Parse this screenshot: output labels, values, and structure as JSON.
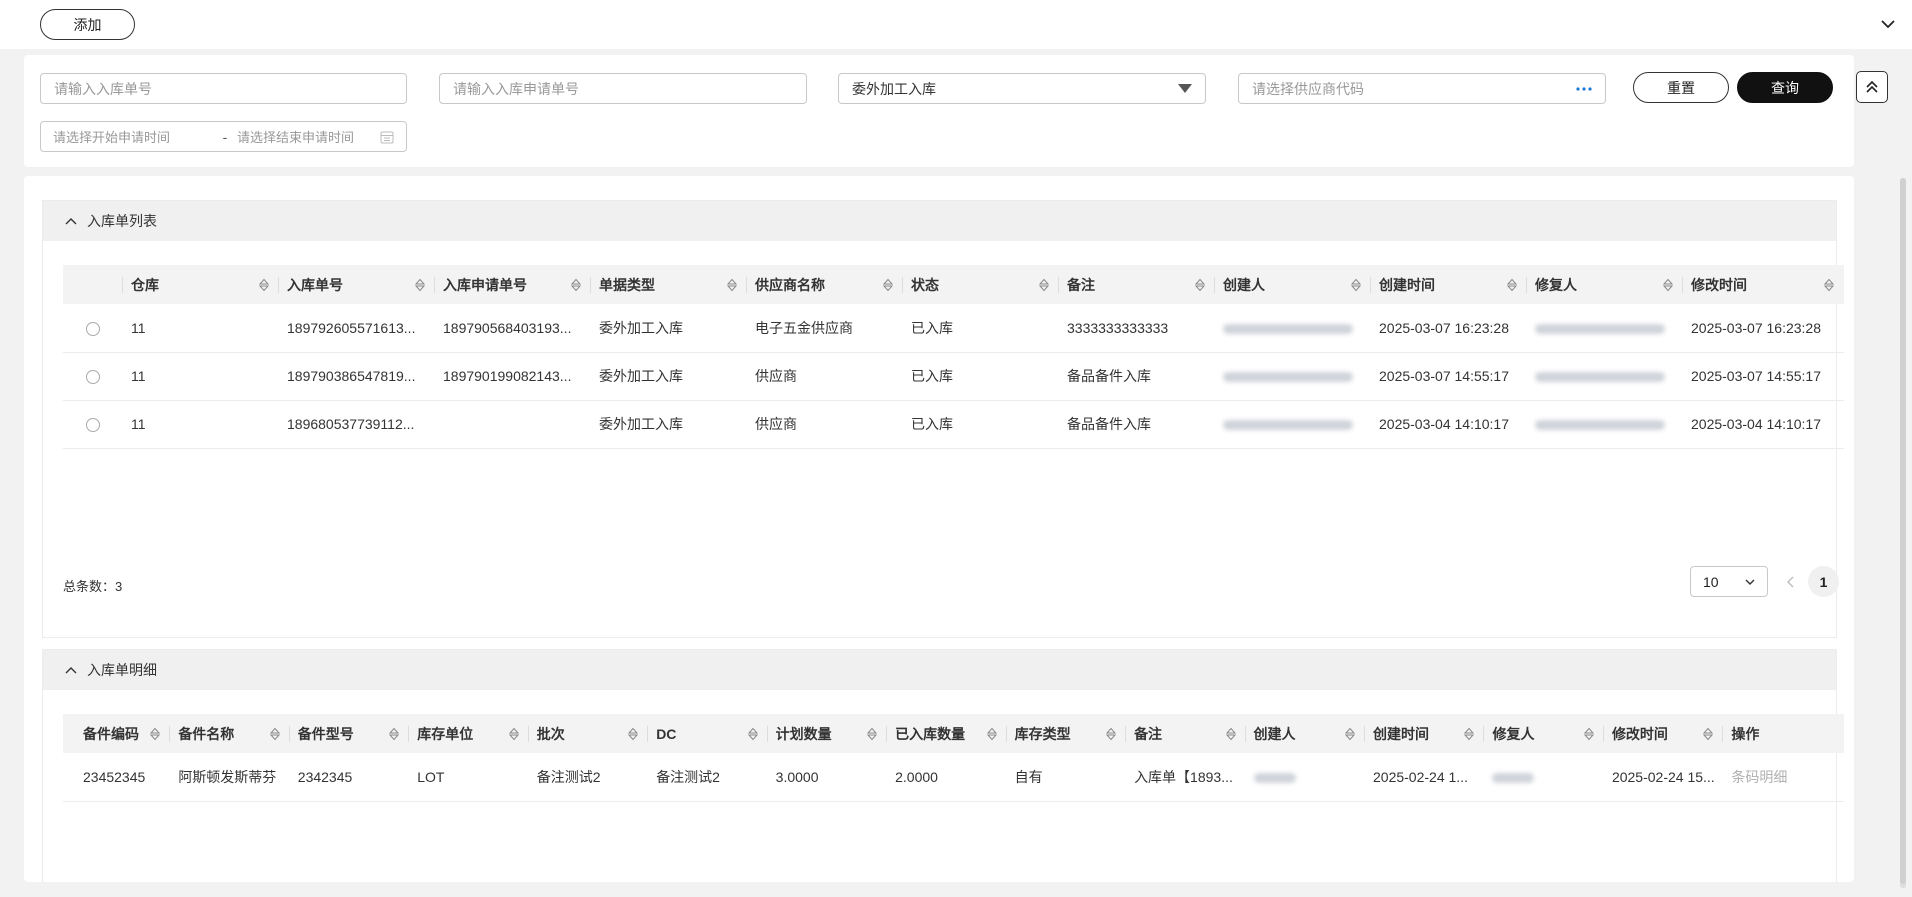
{
  "toolbar": {
    "add_label": "添加"
  },
  "filters": {
    "inbound_no_placeholder": "请输入入库单号",
    "request_no_placeholder": "请输入入库申请单号",
    "type_selected": "委外加工入库",
    "supplier_placeholder": "请选择供应商代码",
    "start_time_placeholder": "请选择开始申请时间",
    "range_sep": "-",
    "end_time_placeholder": "请选择结束申请时间",
    "reset_label": "重置",
    "query_label": "查询"
  },
  "inbound_list": {
    "title": "入库单列表",
    "columns": [
      "仓库",
      "入库单号",
      "入库申请单号",
      "单据类型",
      "供应商名称",
      "状态",
      "备注",
      "创建人",
      "创建时间",
      "修复人",
      "修改时间"
    ],
    "rows": [
      {
        "warehouse": "11",
        "inbound_no": "189792605571613...",
        "request_no": "189790568403193...",
        "type": "委外加工入库",
        "supplier": "电子五金供应商",
        "status": "已入库",
        "remark": "3333333333333",
        "created_time": "2025-03-07 16:23:28",
        "modified_time": "2025-03-07 16:23:28"
      },
      {
        "warehouse": "11",
        "inbound_no": "189790386547819...",
        "request_no": "189790199082143...",
        "type": "委外加工入库",
        "supplier": "供应商",
        "status": "已入库",
        "remark": "备品备件入库",
        "created_time": "2025-03-07 14:55:17",
        "modified_time": "2025-03-07 14:55:17"
      },
      {
        "warehouse": "11",
        "inbound_no": "189680537739112...",
        "request_no": "",
        "type": "委外加工入库",
        "supplier": "供应商",
        "status": "已入库",
        "remark": "备品备件入库",
        "created_time": "2025-03-04 14:10:17",
        "modified_time": "2025-03-04 14:10:17"
      }
    ],
    "total_label": "总条数：3",
    "page_size": "10",
    "current_page": "1"
  },
  "inbound_detail": {
    "title": "入库单明细",
    "columns": [
      "备件编码",
      "备件名称",
      "备件型号",
      "库存单位",
      "批次",
      "DC",
      "计划数量",
      "已入库数量",
      "库存类型",
      "备注",
      "创建人",
      "创建时间",
      "修复人",
      "修改时间",
      "操作"
    ],
    "rows": [
      {
        "code": "23452345",
        "name": "阿斯顿发斯蒂芬",
        "model": "2342345",
        "unit": "LOT",
        "batch": "备注测试2",
        "dc": "备注测试2",
        "plan_qty": "3.0000",
        "in_qty": "2.0000",
        "stock_type": "自有",
        "remark": "入库单【1893...",
        "created_time": "2025-02-24 1...",
        "modified_time": "2025-02-24 15...",
        "action": "条码明细"
      }
    ]
  }
}
